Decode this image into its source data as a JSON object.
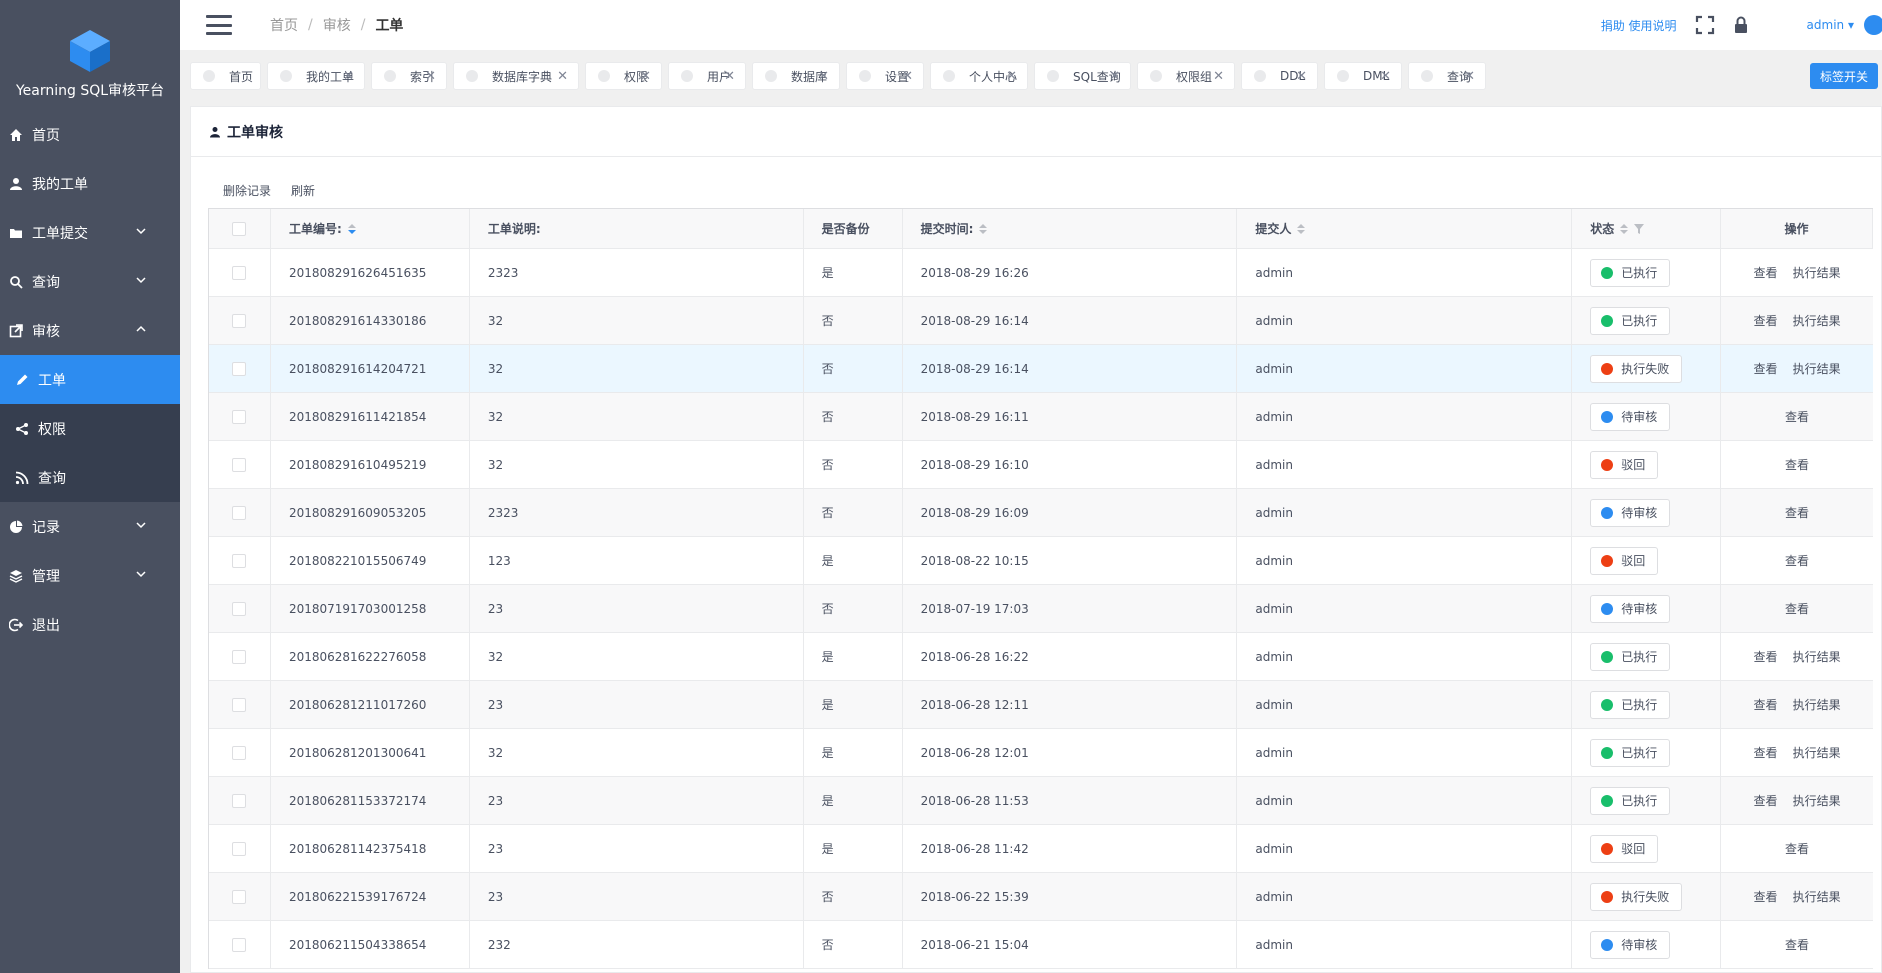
{
  "app": {
    "title": "Yearning SQL审核平台"
  },
  "colors": {
    "accent": "#2d8cf0",
    "sidebar": "#495060",
    "success": "#19be6b",
    "error": "#ed3f14",
    "pending": "#2d8cf0"
  },
  "sidebar": {
    "items": [
      {
        "label": "首页",
        "icon": "home-icon"
      },
      {
        "label": "我的工单",
        "icon": "person-icon"
      },
      {
        "label": "工单提交",
        "icon": "folder-icon"
      },
      {
        "label": "查询",
        "icon": "search-icon"
      },
      {
        "label": "审核",
        "icon": "external-link-icon"
      },
      {
        "label": "记录",
        "icon": "pie-chart-icon"
      },
      {
        "label": "管理",
        "icon": "layers-icon"
      },
      {
        "label": "退出",
        "icon": "logout-icon"
      }
    ],
    "submenu": [
      {
        "label": "工单",
        "icon": "pencil-icon"
      },
      {
        "label": "权限",
        "icon": "share-icon"
      },
      {
        "label": "查询",
        "icon": "rss-icon"
      }
    ]
  },
  "header": {
    "breadcrumb": [
      "首页",
      "审核",
      "工单"
    ],
    "donate": "捐助",
    "usage": "使用说明",
    "user": "admin"
  },
  "tags": {
    "items": [
      "首页",
      "我的工单",
      "索引",
      "数据库字典",
      "权限",
      "用户",
      "数据库",
      "设置",
      "个人中心",
      "SQL查询",
      "权限组",
      "DDL",
      "DML",
      "查询"
    ],
    "switch_label": "标签开关"
  },
  "card": {
    "title": "工单审核",
    "actions": {
      "delete": "删除记录",
      "refresh": "刷新"
    }
  },
  "table": {
    "columns": [
      "工单编号:",
      "工单说明:",
      "是否备份",
      "提交时间:",
      "提交人",
      "状态",
      "操作"
    ],
    "view_label": "查看",
    "result_label": "执行结果",
    "rows": [
      {
        "id": "201808291626451635",
        "desc": "2323",
        "backup": "是",
        "time": "2018-08-29 16:26",
        "user": "admin",
        "status": "已执行",
        "state": "success"
      },
      {
        "id": "201808291614330186",
        "desc": "32",
        "backup": "否",
        "time": "2018-08-29 16:14",
        "user": "admin",
        "status": "已执行",
        "state": "success"
      },
      {
        "id": "201808291614204721",
        "desc": "32",
        "backup": "否",
        "time": "2018-08-29 16:14",
        "user": "admin",
        "status": "执行失败",
        "state": "error"
      },
      {
        "id": "201808291611421854",
        "desc": "32",
        "backup": "否",
        "time": "2018-08-29 16:11",
        "user": "admin",
        "status": "待审核",
        "state": "pending"
      },
      {
        "id": "201808291610495219",
        "desc": "32",
        "backup": "否",
        "time": "2018-08-29 16:10",
        "user": "admin",
        "status": "驳回",
        "state": "rejected"
      },
      {
        "id": "201808291609053205",
        "desc": "2323",
        "backup": "否",
        "time": "2018-08-29 16:09",
        "user": "admin",
        "status": "待审核",
        "state": "pending"
      },
      {
        "id": "201808221015506749",
        "desc": "123",
        "backup": "是",
        "time": "2018-08-22 10:15",
        "user": "admin",
        "status": "驳回",
        "state": "rejected"
      },
      {
        "id": "201807191703001258",
        "desc": "23",
        "backup": "否",
        "time": "2018-07-19 17:03",
        "user": "admin",
        "status": "待审核",
        "state": "pending"
      },
      {
        "id": "201806281622276058",
        "desc": "32",
        "backup": "是",
        "time": "2018-06-28 16:22",
        "user": "admin",
        "status": "已执行",
        "state": "success"
      },
      {
        "id": "201806281211017260",
        "desc": "23",
        "backup": "是",
        "time": "2018-06-28 12:11",
        "user": "admin",
        "status": "已执行",
        "state": "success"
      },
      {
        "id": "201806281201300641",
        "desc": "32",
        "backup": "是",
        "time": "2018-06-28 12:01",
        "user": "admin",
        "status": "已执行",
        "state": "success"
      },
      {
        "id": "201806281153372174",
        "desc": "23",
        "backup": "是",
        "time": "2018-06-28 11:53",
        "user": "admin",
        "status": "已执行",
        "state": "success"
      },
      {
        "id": "201806281142375418",
        "desc": "23",
        "backup": "是",
        "time": "2018-06-28 11:42",
        "user": "admin",
        "status": "驳回",
        "state": "rejected"
      },
      {
        "id": "201806221539176724",
        "desc": "23",
        "backup": "否",
        "time": "2018-06-22 15:39",
        "user": "admin",
        "status": "执行失败",
        "state": "error"
      },
      {
        "id": "201806211504338654",
        "desc": "232",
        "backup": "否",
        "time": "2018-06-21 15:04",
        "user": "admin",
        "status": "待审核",
        "state": "pending"
      }
    ]
  }
}
